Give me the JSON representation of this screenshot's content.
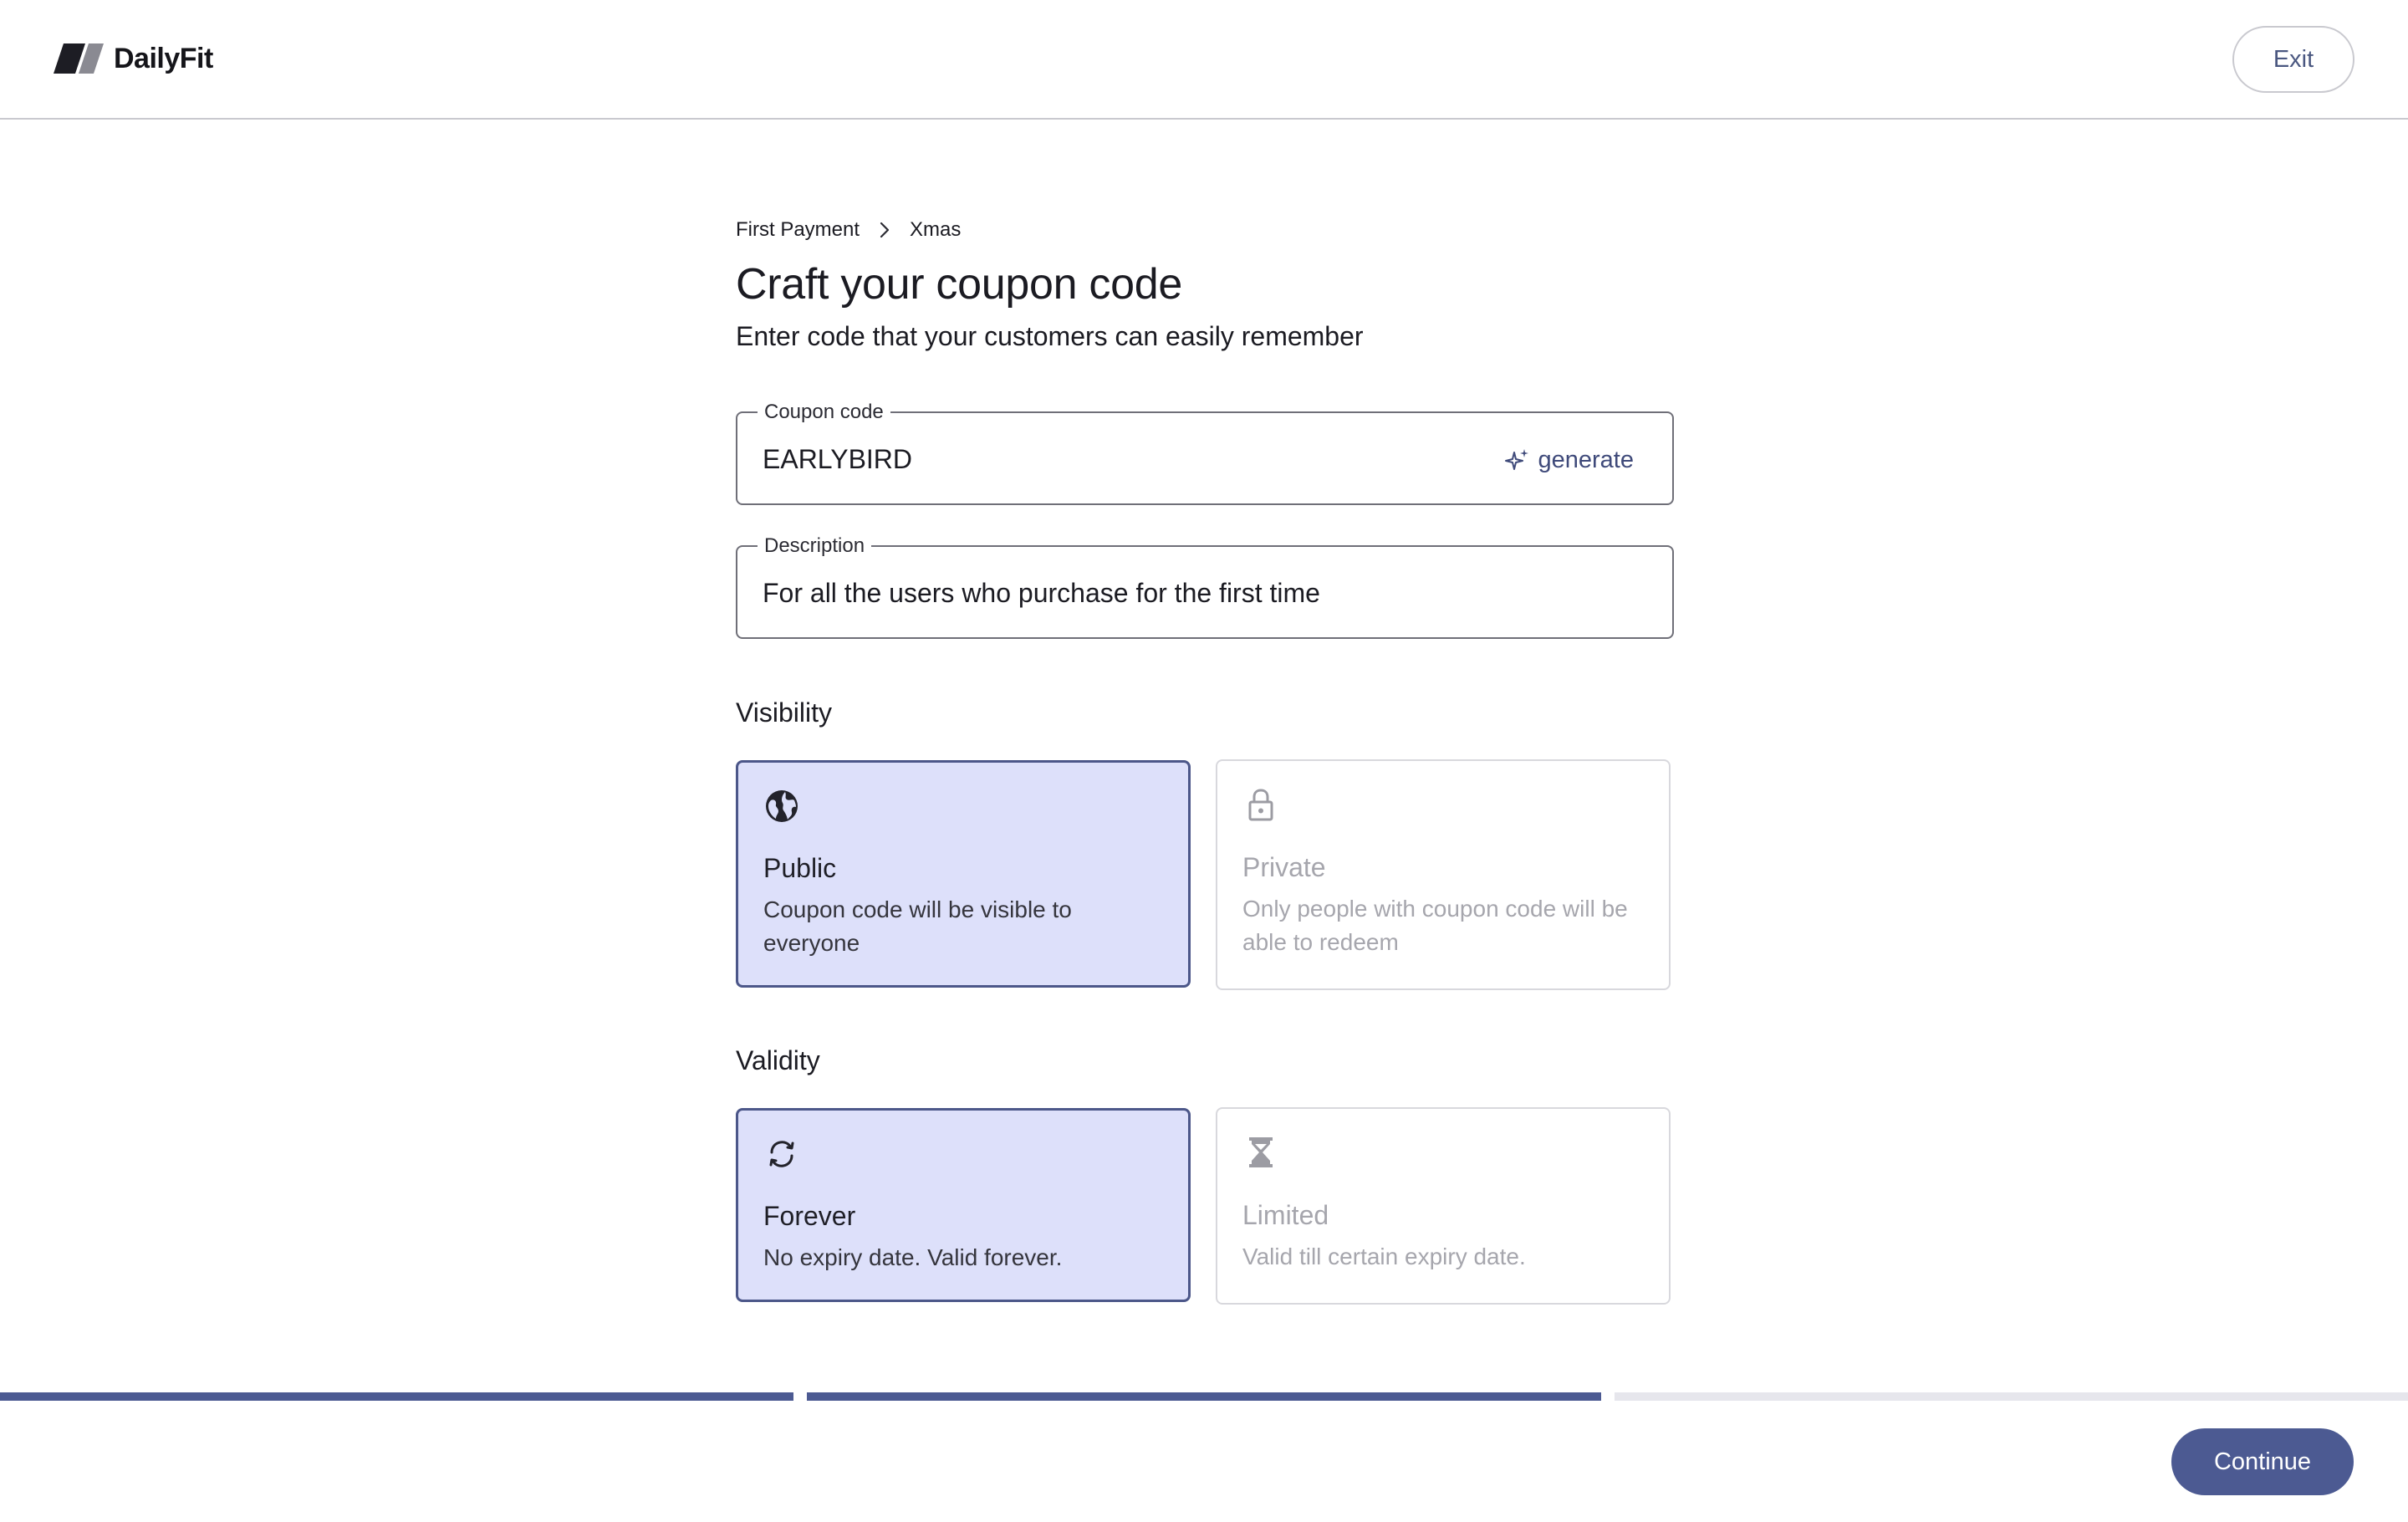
{
  "app": {
    "name": "DailyFit",
    "logo_icon": "dailyfit-logo-icon"
  },
  "header": {
    "exit_label": "Exit"
  },
  "breadcrumb": {
    "items": [
      "First Payment",
      "Xmas"
    ],
    "separator_icon": "chevron-right-icon"
  },
  "page": {
    "title": "Craft your coupon code",
    "subtitle": "Enter code that your customers can easily remember"
  },
  "form": {
    "coupon_code": {
      "label": "Coupon code",
      "value": "EARLYBIRD",
      "action_label": "generate",
      "action_icon": "sparkle-icon"
    },
    "description": {
      "label": "Description",
      "value": "For all the users who purchase for the first time"
    }
  },
  "visibility": {
    "label": "Visibility",
    "options": [
      {
        "title": "Public",
        "description": "Coupon code will be visible to everyone",
        "icon": "globe-icon",
        "selected": true
      },
      {
        "title": "Private",
        "description": "Only people with coupon code will be able to redeem",
        "icon": "lock-icon",
        "selected": false
      }
    ]
  },
  "validity": {
    "label": "Validity",
    "options": [
      {
        "title": "Forever",
        "description": "No expiry date. Valid forever.",
        "icon": "refresh-icon",
        "selected": true
      },
      {
        "title": "Limited",
        "description": "Valid till certain expiry date.",
        "icon": "hourglass-icon",
        "selected": false
      }
    ]
  },
  "progress": {
    "steps_total": 3,
    "steps_completed": 2,
    "active_color": "#4c5a92",
    "inactive_color": "#e6e6ec"
  },
  "footer": {
    "continue_label": "Continue"
  },
  "colors": {
    "accent": "#4c5a92",
    "selected_card_bg": "#dde0fa",
    "selected_card_border": "#4c5789"
  }
}
